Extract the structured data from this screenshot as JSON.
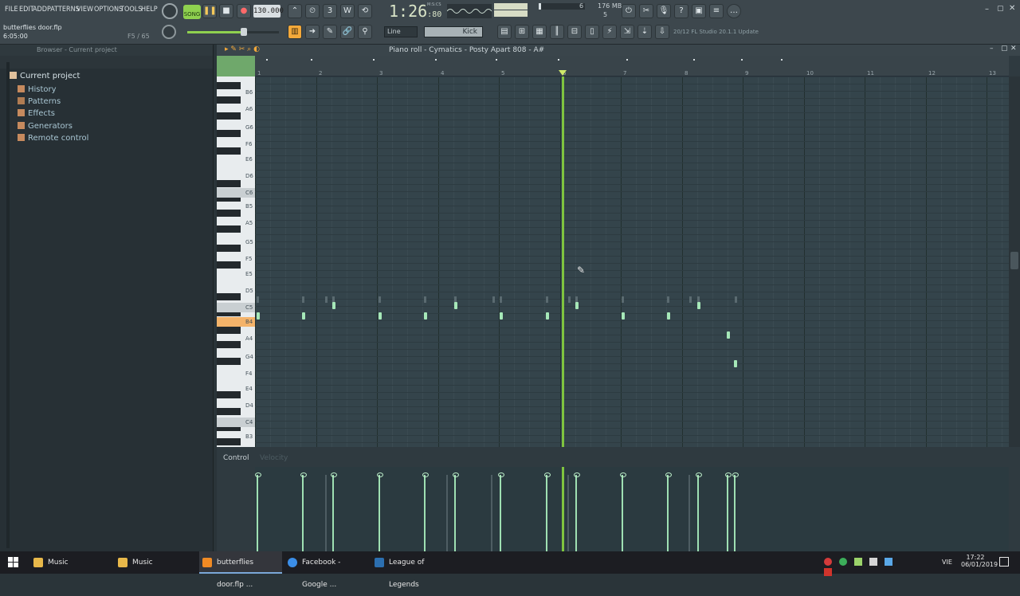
{
  "menu": [
    "FILE",
    "EDIT",
    "ADD",
    "PATTERNS",
    "VIEW",
    "OPTIONS",
    "TOOLS",
    "HELP"
  ],
  "project": {
    "file": "butterflies door.flp",
    "time": "6:05:00",
    "pos": "F5 / 65"
  },
  "transport": {
    "mode": "SONG",
    "tempo": "130.000",
    "time_main": "1:26",
    "time_sub": "80",
    "time_unit": "M:S:CS"
  },
  "memory": {
    "mb": "176 MB",
    "voices": "6",
    "cpu": "5"
  },
  "toolbar2": {
    "snap": "Line",
    "channel": "Kick",
    "news": "20/12  FL Studio 20.1.1 Update"
  },
  "browser": {
    "header": "Browser - Current project",
    "root": "Current project",
    "items": [
      "History",
      "Patterns",
      "Effects",
      "Generators",
      "Remote control"
    ]
  },
  "pianoroll": {
    "title": "Piano roll - Cymatics - Posty Apart 808 - A#",
    "bars": [
      "1",
      "2",
      "3",
      "4",
      "5",
      "6",
      "7",
      "8",
      "9",
      "10",
      "11",
      "12",
      "13"
    ],
    "keys": [
      "B6",
      "A6",
      "G6",
      "F6",
      "E6",
      "D6",
      "C6",
      "B5",
      "A5",
      "G5",
      "F5",
      "E5",
      "D5",
      "C5",
      "B4",
      "A4",
      "G4",
      "F4",
      "E4",
      "D4",
      "C4",
      "B3"
    ],
    "highlight_key": "B4",
    "control_label": "Control",
    "control_param": "Velocity"
  },
  "taskbar": {
    "items": [
      "Music",
      "Music",
      "butterflies door.flp ...",
      "Facebook - Google ...",
      "League of Legends"
    ],
    "lang": "VIE",
    "clock": "17:22",
    "date": "06/01/2019"
  },
  "colors": {
    "accent": "#f4a93a",
    "note": "#a6e8b8",
    "playhead": "#7fc43f"
  }
}
